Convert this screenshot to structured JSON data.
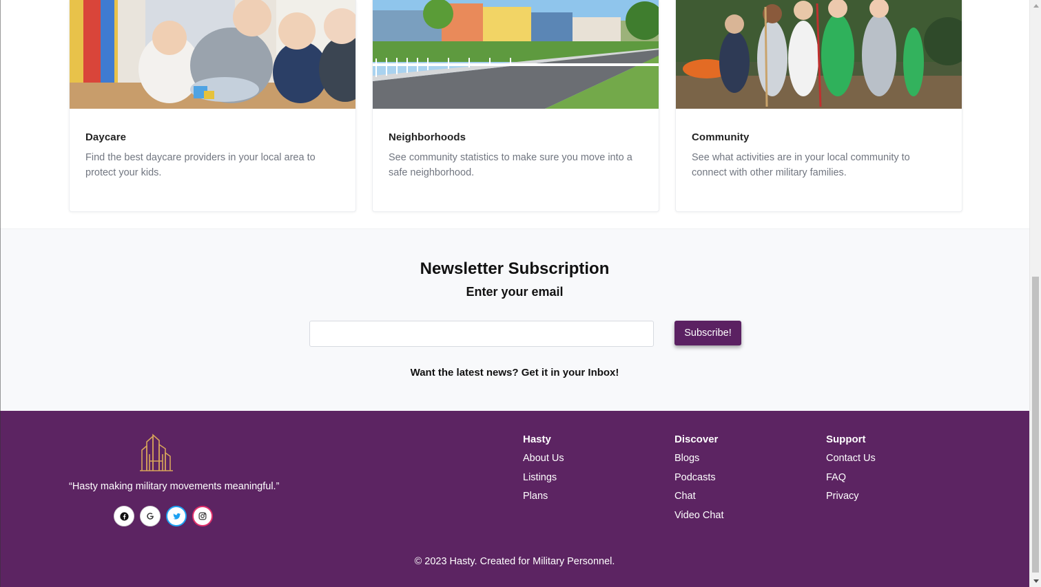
{
  "cards": [
    {
      "title": "Daycare",
      "description": "Find the best daycare providers in your local area to protect your kids."
    },
    {
      "title": "Neighborhoods",
      "description": "See community statistics to make sure you move into a safe neighborhood."
    },
    {
      "title": "Community",
      "description": "See what activities are in your local community to connect with other military families."
    }
  ],
  "newsletter": {
    "title": "Newsletter Subscription",
    "subtitle": "Enter your email",
    "email_value": "",
    "button_label": "Subscribe!",
    "note": "Want the latest news? Get it in your Inbox!"
  },
  "footer": {
    "tagline": "“Hasty making military movements meaningful.”",
    "socials": [
      "facebook-icon",
      "google-icon",
      "twitter-icon",
      "instagram-icon"
    ],
    "columns": [
      {
        "heading": "Hasty",
        "links": [
          "About Us",
          "Listings",
          "Plans"
        ]
      },
      {
        "heading": "Discover",
        "links": [
          "Blogs",
          "Podcasts",
          "Chat",
          "Video Chat"
        ]
      },
      {
        "heading": "Support",
        "links": [
          "Contact Us",
          "FAQ",
          "Privacy"
        ]
      }
    ],
    "copyright": "© 2023 Hasty. Created for Military Personnel."
  },
  "colors": {
    "brand_purple": "#5c2462",
    "button_purple": "#5b2162",
    "logo_gold": "#d7a55a",
    "twitter_blue": "#1da1f2",
    "instagram_pink": "#e1306c"
  }
}
